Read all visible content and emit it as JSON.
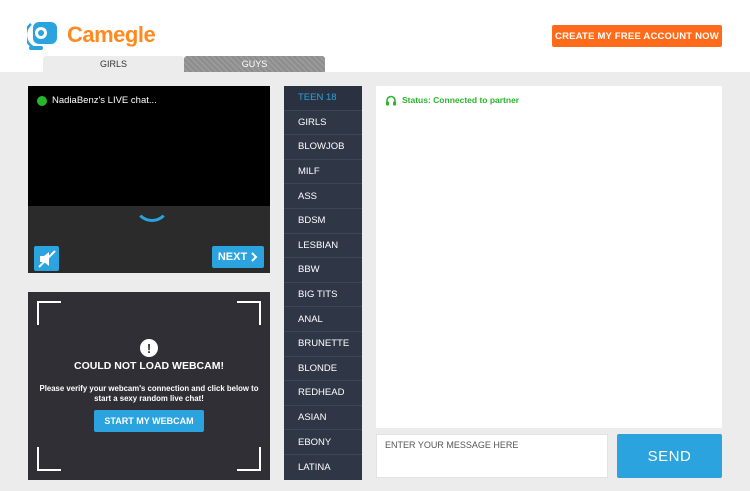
{
  "header": {
    "logo_text": "Camegle",
    "create_account_label": "CREATE MY FREE ACCOUNT NOW"
  },
  "tabs": [
    {
      "label": "GIRLS"
    },
    {
      "label": "GUYS"
    }
  ],
  "video": {
    "live_label": "NadiaBenz's LIVE chat...",
    "next_label": "NEXT",
    "mute_icon": "speaker-muted-icon",
    "status_dot_color": "#28b52a"
  },
  "webcam": {
    "icon": "exclamation-icon",
    "title": "COULD NOT LOAD WEBCAM!",
    "message": "Please verify your webcam's connection and click below to start a sexy random live chat!",
    "start_label": "START MY WEBCAM"
  },
  "categories": [
    {
      "label": "TEEN 18",
      "active": true
    },
    {
      "label": "GIRLS"
    },
    {
      "label": "BLOWJOB"
    },
    {
      "label": "MILF"
    },
    {
      "label": "ASS"
    },
    {
      "label": "BDSM"
    },
    {
      "label": "LESBIAN"
    },
    {
      "label": "BBW"
    },
    {
      "label": "BIG TITS"
    },
    {
      "label": "ANAL"
    },
    {
      "label": "BRUNETTE"
    },
    {
      "label": "BLONDE"
    },
    {
      "label": "REDHEAD"
    },
    {
      "label": "ASIAN"
    },
    {
      "label": "EBONY"
    },
    {
      "label": "LATINA"
    }
  ],
  "chat": {
    "status_icon": "headset-icon",
    "status_text": "Status: Connected to partner",
    "input_placeholder": "ENTER YOUR MESSAGE HERE",
    "send_label": "SEND"
  },
  "colors": {
    "accent_blue": "#2aa3df",
    "brand_orange": "#ff6b1a",
    "status_green": "#28b52a",
    "sidebar_dark": "#2f3746"
  }
}
